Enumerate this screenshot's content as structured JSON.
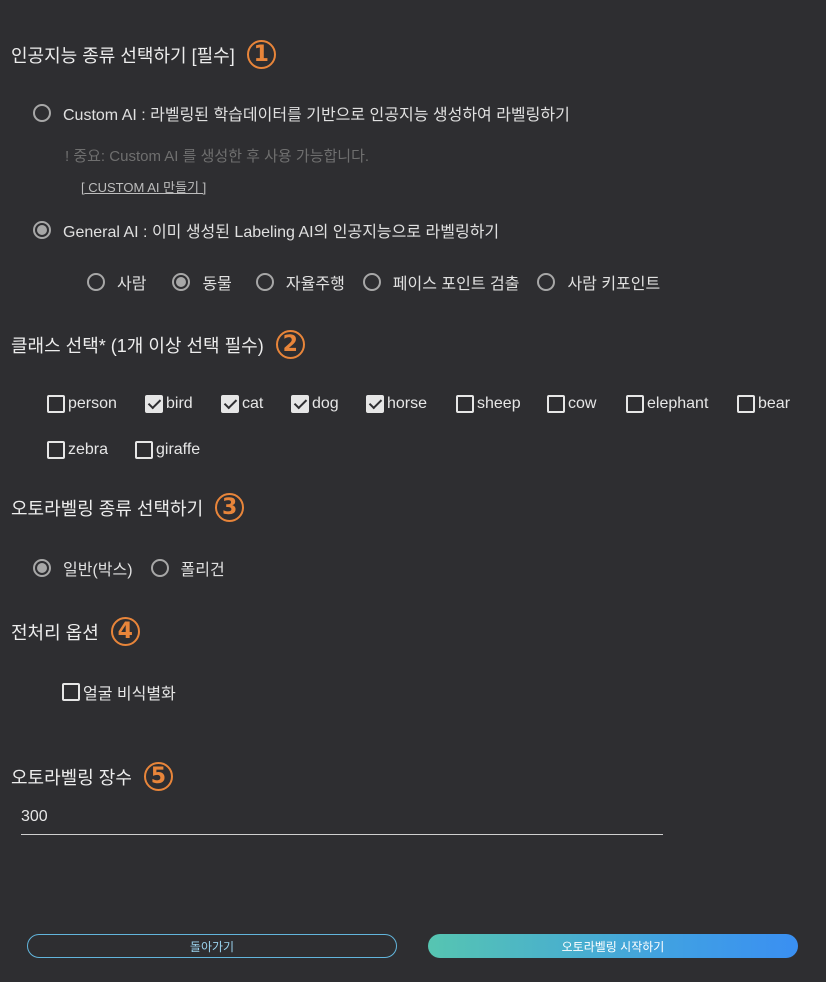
{
  "sections": {
    "ai_type": {
      "title": "인공지능 종류 선택하기 [필수]",
      "step": "1"
    },
    "classes": {
      "title": "클래스 선택* (1개 이상 선택 필수)",
      "step": "2"
    },
    "label_type": {
      "title": "오토라벨링 종류 선택하기",
      "step": "3"
    },
    "preprocess": {
      "title": "전처리 옵션",
      "step": "4"
    },
    "count": {
      "title": "오토라벨링 장수",
      "step": "5"
    }
  },
  "ai_type": {
    "custom": {
      "label": "Custom AI : 라벨링된 학습데이터를 기반으로 인공지능 생성하여 라벨링하기",
      "selected": false
    },
    "note": "! 중요: Custom AI 를 생성한 후 사용 가능합니다.",
    "create_link": "[ CUSTOM AI 만들기 ]",
    "general": {
      "label": "General AI : 이미 생성된 Labeling AI의 인공지능으로 라벨링하기",
      "selected": true
    },
    "sub_options": [
      {
        "label": "사람",
        "selected": false
      },
      {
        "label": "동물",
        "selected": true
      },
      {
        "label": "자율주행",
        "selected": false
      },
      {
        "label": "페이스 포인트 검출",
        "selected": false
      },
      {
        "label": "사람 키포인트",
        "selected": false
      }
    ]
  },
  "classes": [
    {
      "label": "person",
      "checked": false
    },
    {
      "label": "bird",
      "checked": true
    },
    {
      "label": "cat",
      "checked": true
    },
    {
      "label": "dog",
      "checked": true
    },
    {
      "label": "horse",
      "checked": true
    },
    {
      "label": "sheep",
      "checked": false
    },
    {
      "label": "cow",
      "checked": false
    },
    {
      "label": "elephant",
      "checked": false
    },
    {
      "label": "bear",
      "checked": false
    },
    {
      "label": "zebra",
      "checked": false
    },
    {
      "label": "giraffe",
      "checked": false
    }
  ],
  "label_type": [
    {
      "label": "일반(박스)",
      "selected": true
    },
    {
      "label": "폴리건",
      "selected": false
    }
  ],
  "preprocess": {
    "face_blur": {
      "label": "얼굴 비식별화",
      "checked": false
    }
  },
  "count": {
    "value": "300"
  },
  "buttons": {
    "back": "돌아가기",
    "start": "오토라벨링 시작하기"
  },
  "colors": {
    "background": "#2e2e31",
    "step_accent": "#e8853a",
    "back_border": "#62b5dc",
    "start_gradient_from": "#56c5b1",
    "start_gradient_to": "#3a8ff2"
  }
}
